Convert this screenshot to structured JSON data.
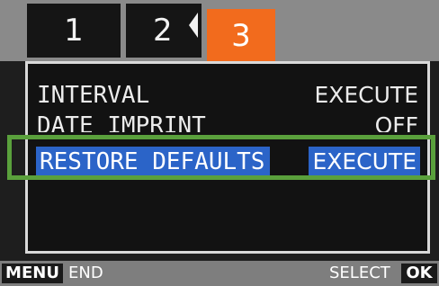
{
  "tabs": [
    {
      "label": "1"
    },
    {
      "label": "2"
    },
    {
      "label": "3",
      "active": true
    }
  ],
  "menu": {
    "rows": [
      {
        "label": "INTERVAL",
        "value": "EXECUTE"
      },
      {
        "label": "DATE IMPRINT",
        "value": "OFF"
      },
      {
        "label": "RESTORE DEFAULTS",
        "value": "EXECUTE",
        "selected": true
      }
    ]
  },
  "footer": {
    "menu_key": "MENU",
    "menu_hint": "END",
    "select_hint": "SELECT",
    "ok_key": "OK"
  },
  "colors": {
    "active_tab": "#f26b1d",
    "selection": "#2b64c8",
    "highlight_frame": "#5aa03c"
  }
}
